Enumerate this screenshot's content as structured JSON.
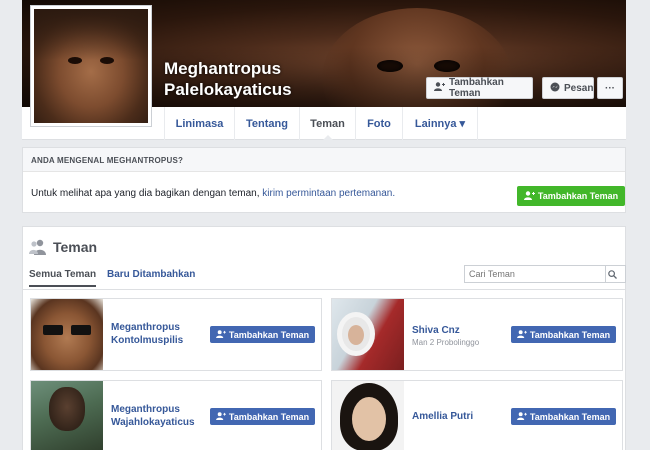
{
  "profile": {
    "name_line1": "Meghantropus",
    "name_line2": "Palelokayaticus"
  },
  "cover_actions": {
    "add_friend": "Tambahkan Teman",
    "message": "Pesan",
    "more": "···"
  },
  "nav": {
    "tabs": [
      {
        "label": "Linimasa"
      },
      {
        "label": "Tentang"
      },
      {
        "label": "Teman",
        "active": true
      },
      {
        "label": "Foto"
      },
      {
        "label": "Lainnya ▾"
      }
    ]
  },
  "know_card": {
    "heading": "ANDA MENGENAL MEGHANTROPUS?",
    "text_prefix": "Untuk melihat apa yang dia bagikan dengan teman, ",
    "link_text": "kirim permintaan pertemanan.",
    "button": "Tambahkan Teman"
  },
  "friends": {
    "title": "Teman",
    "subtab_all": "Semua Teman",
    "subtab_recent": "Baru Ditambahkan",
    "search_placeholder": "Cari Teman",
    "add_label": "Tambahkan Teman",
    "items": [
      {
        "name_line1": "Meganthropus",
        "name_line2": "Kontolmuspilis",
        "meta": ""
      },
      {
        "name_line1": "Shiva Cnz",
        "name_line2": "",
        "meta": "Man 2 Probolinggo"
      },
      {
        "name_line1": "Meganthropus",
        "name_line2": "Wajahlokayaticus",
        "meta": ""
      },
      {
        "name_line1": "Amellia Putri",
        "name_line2": "",
        "meta": ""
      }
    ]
  },
  "colors": {
    "link": "#365899",
    "primary_button": "#4267b2",
    "green_button": "#42b72a",
    "page_bg": "#e9ebee"
  },
  "icons": {
    "add_friend": "add-friend-icon",
    "message": "messenger-icon",
    "search": "search-icon",
    "friends": "friends-icon"
  }
}
